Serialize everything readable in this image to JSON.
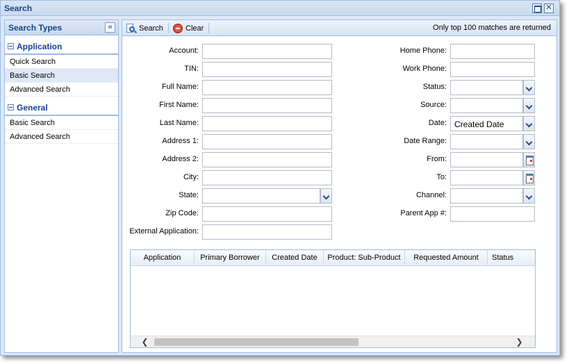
{
  "window": {
    "title": "Search"
  },
  "left_panel": {
    "header": "Search Types",
    "groups": [
      {
        "label": "Application",
        "items": [
          "Quick Search",
          "Basic Search",
          "Advanced Search"
        ]
      },
      {
        "label": "General",
        "items": [
          "Basic Search",
          "Advanced Search"
        ]
      }
    ]
  },
  "toolbar": {
    "search_label": "Search",
    "clear_label": "Clear",
    "note": "Only top 100 matches are returned"
  },
  "form": {
    "left": {
      "account": "Account:",
      "tin": "TIN:",
      "full_name": "Full Name:",
      "first_name": "First Name:",
      "last_name": "Last Name:",
      "address1": "Address 1:",
      "address2": "Address 2:",
      "city": "City:",
      "state": "State:",
      "zip": "Zip Code:",
      "external_app": "External Application:"
    },
    "right": {
      "home_phone": "Home Phone:",
      "work_phone": "Work Phone:",
      "status": "Status:",
      "source": "Source:",
      "date": "Date:",
      "date_value": "Created Date",
      "date_range": "Date Range:",
      "from": "From:",
      "to": "To:",
      "channel": "Channel:",
      "parent_app": "Parent App #:"
    }
  },
  "grid": {
    "columns": [
      "Application",
      "Primary Borrower",
      "Created Date",
      "Product: Sub-Product",
      "Requested Amount",
      "Status"
    ]
  }
}
